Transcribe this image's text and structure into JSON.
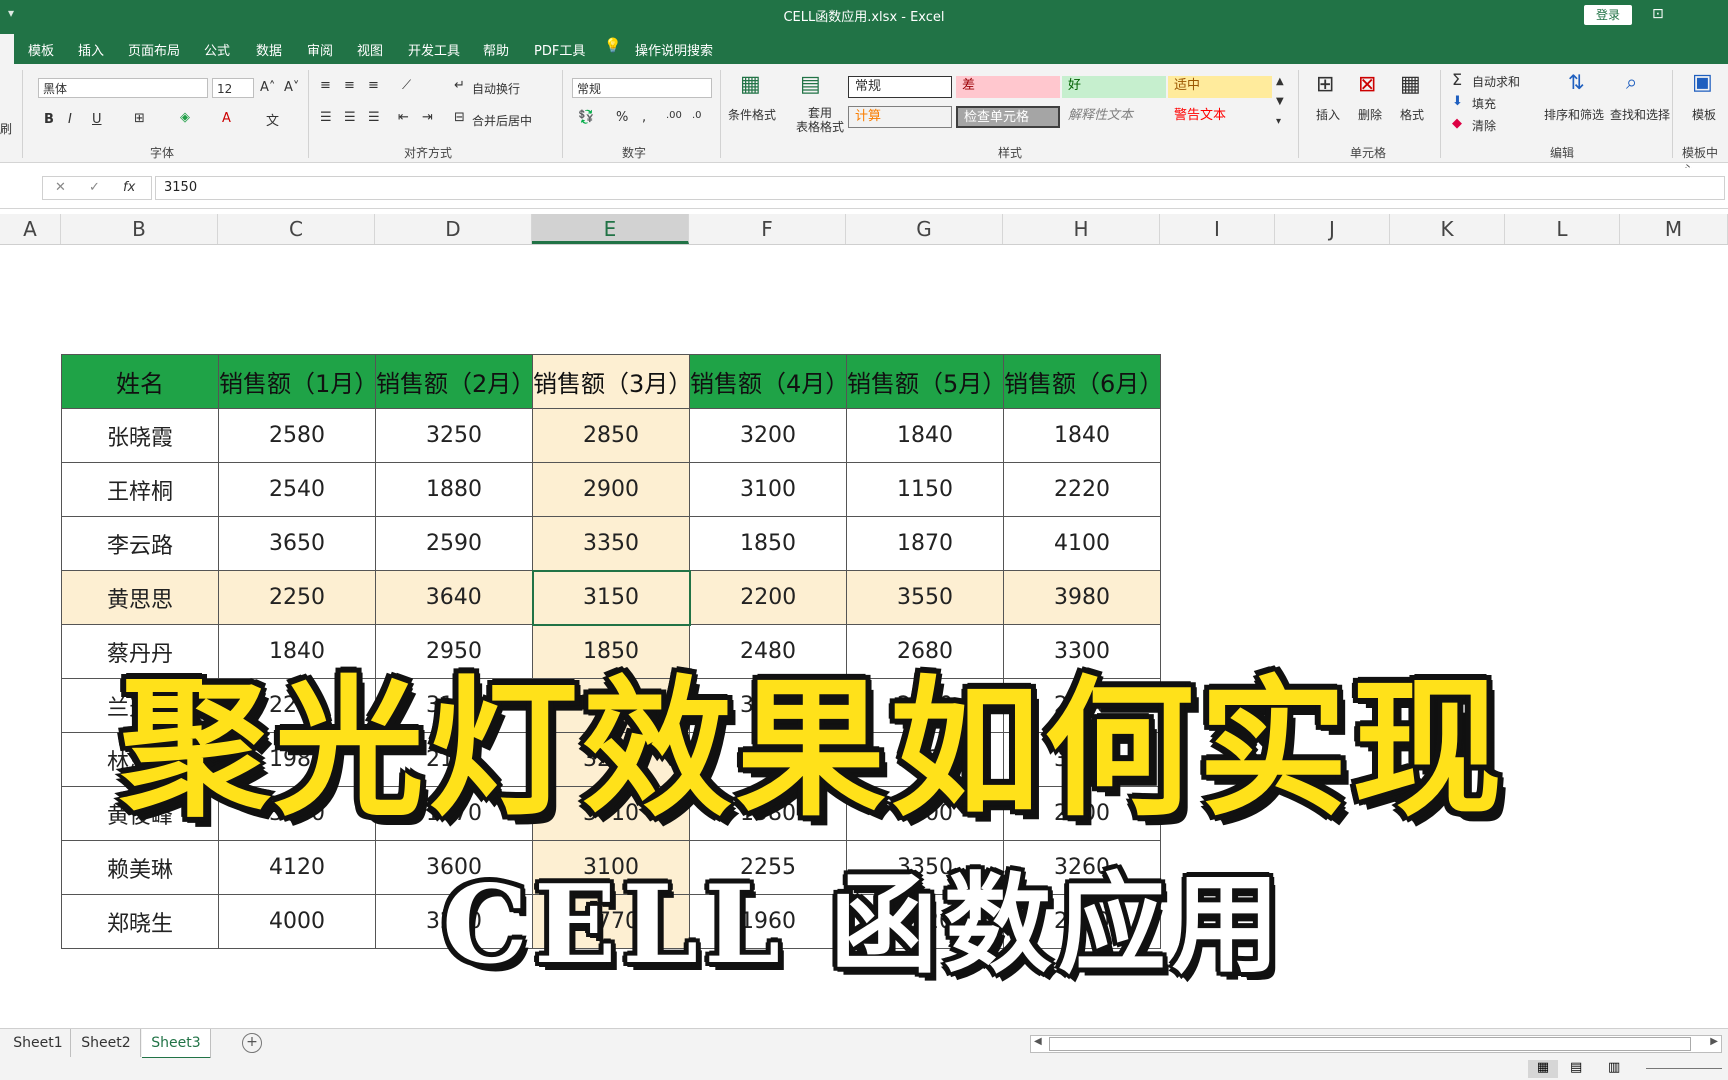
{
  "window": {
    "title": "CELL函数应用.xlsx  -  Excel",
    "login": "登录",
    "qat": "▾"
  },
  "tabs": [
    "模板",
    "插入",
    "页面布局",
    "公式",
    "数据",
    "审阅",
    "视图",
    "开发工具",
    "帮助",
    "PDF工具",
    "操作说明搜索"
  ],
  "ribbon": {
    "font_name": "黑体",
    "font_size": "12",
    "font_group": "字体",
    "align_group": "对齐方式",
    "wrap_text": "自动换行",
    "merge_center": "合并后居中",
    "number_format": "常规",
    "number_group": "数字",
    "cond_format": "条件格式",
    "table_format": "套用\n表格格式",
    "styles_group": "样式",
    "styles": {
      "normal": "常规",
      "bad": "差",
      "good": "好",
      "neutral": "适中",
      "calc": "计算",
      "check": "检查单元格",
      "explanatory": "解释性文本",
      "warning": "警告文本"
    },
    "insert": "插入",
    "delete": "删除",
    "format": "格式",
    "cells_group": "单元格",
    "autosum": "自动求和",
    "fill": "填充",
    "clear": "清除",
    "sort_filter": "排序和筛选",
    "find_select": "查找和选择",
    "editing_group": "编辑",
    "template": "模板",
    "template_center": "模板中心",
    "left_partial": "刷"
  },
  "formula_bar": {
    "value": "3150",
    "fx": "fx"
  },
  "columns": [
    "A",
    "B",
    "C",
    "D",
    "E",
    "F",
    "G",
    "H",
    "I",
    "J",
    "K",
    "L",
    "M"
  ],
  "table": {
    "headers": [
      "姓名",
      "销售额（1月）",
      "销售额（2月）",
      "销售额（3月）",
      "销售额（4月）",
      "销售额（5月）",
      "销售额（6月）"
    ],
    "rows": [
      [
        "张晓霞",
        "2580",
        "3250",
        "2850",
        "3200",
        "1840",
        "1840"
      ],
      [
        "王梓桐",
        "2540",
        "1880",
        "2900",
        "3100",
        "1150",
        "2220"
      ],
      [
        "李云路",
        "3650",
        "2590",
        "3350",
        "1850",
        "1870",
        "4100"
      ],
      [
        "黄思思",
        "2250",
        "3640",
        "3150",
        "2200",
        "3550",
        "3980"
      ],
      [
        "蔡丹丹",
        "1840",
        "2950",
        "1850",
        "2480",
        "2680",
        "3300"
      ],
      [
        "兰天宇",
        "2250",
        "3150",
        "2160",
        "3210",
        "2550",
        "2150"
      ],
      [
        "林思瑶",
        "1980",
        "2100",
        "3280",
        "2740",
        "1260",
        "3480"
      ],
      [
        "黄俊峰",
        "3650",
        "1870",
        "3710",
        "1580",
        "3600",
        "2800"
      ],
      [
        "赖美琳",
        "4120",
        "3600",
        "3100",
        "2255",
        "3350",
        "3260"
      ],
      [
        "郑晓生",
        "4000",
        "3200",
        "2770",
        "1960",
        "2520",
        "2380"
      ]
    ]
  },
  "overlay": {
    "title": "聚光灯效果如何实现",
    "subtitle": "CELL 函数应用"
  },
  "sheets": [
    "Sheet1",
    "Sheet2",
    "Sheet3"
  ],
  "active_sheet": "Sheet3"
}
